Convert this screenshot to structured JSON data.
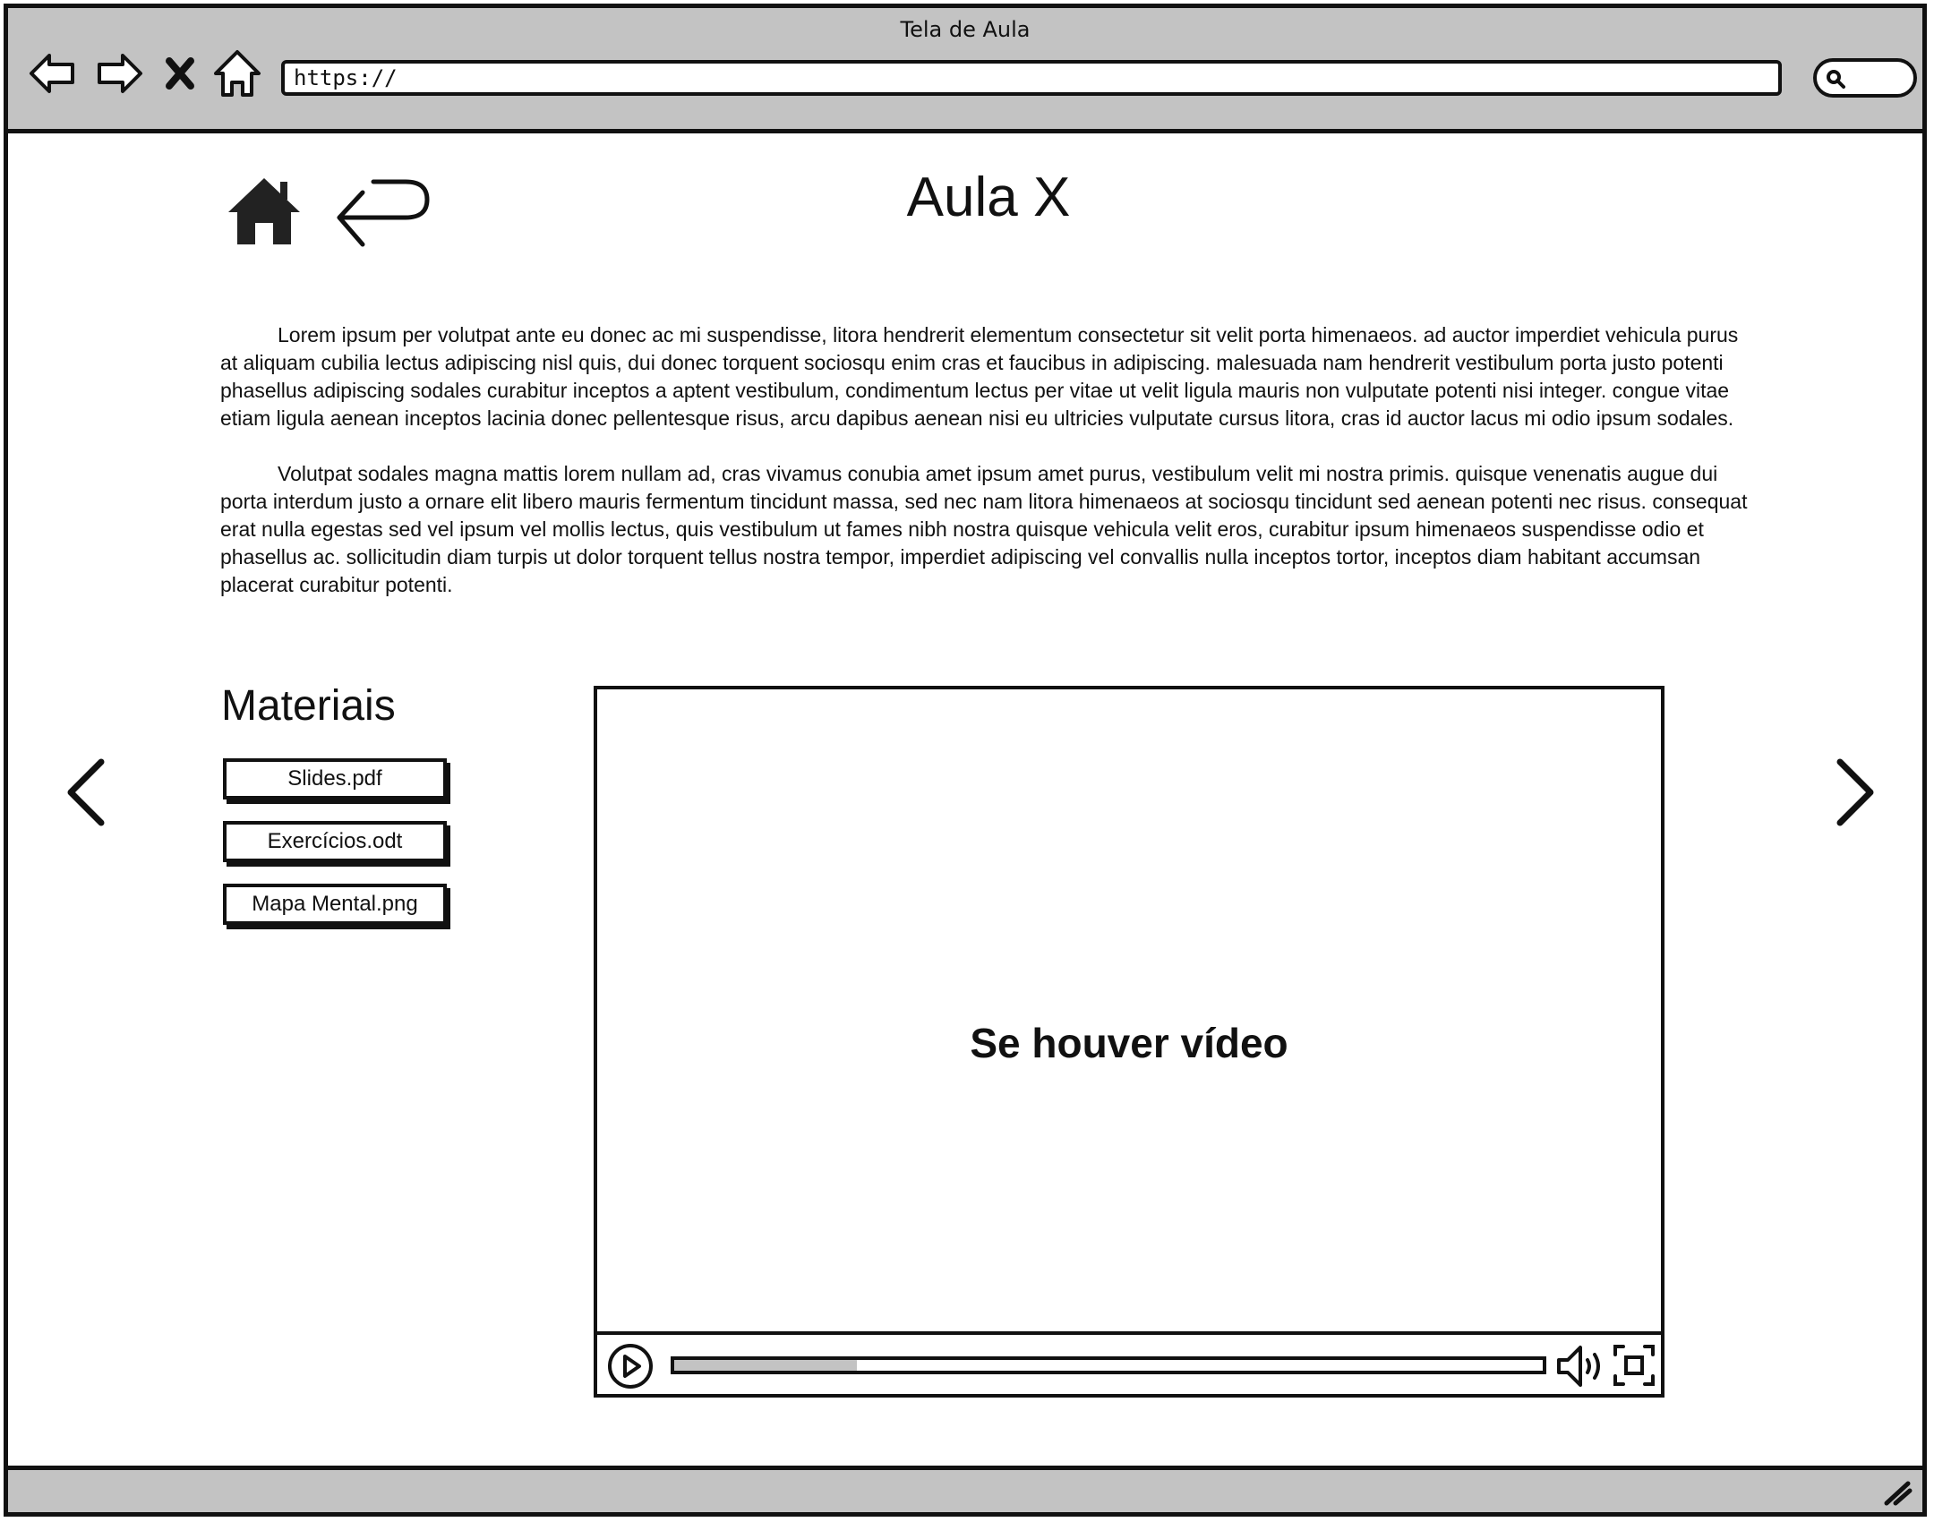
{
  "browser": {
    "window_title": "Tela de Aula",
    "address": "https://",
    "buttons": [
      "back-icon",
      "forward-icon",
      "close-icon",
      "home-icon"
    ],
    "search_icon": "search-icon"
  },
  "page": {
    "title": "Aula X",
    "nav": {
      "home_icon": "home-icon",
      "return_icon": "return-arrow-icon"
    },
    "paragraphs": [
      "Lorem ipsum per volutpat ante eu donec ac mi suspendisse, litora hendrerit elementum consectetur sit velit porta himenaeos. ad auctor imperdiet vehicula purus at aliquam cubilia lectus adipiscing nisl quis, dui donec torquent sociosqu enim cras et faucibus in adipiscing. malesuada nam hendrerit vestibulum porta justo potenti phasellus adipiscing sodales curabitur inceptos a aptent vestibulum, condimentum lectus per vitae ut velit ligula mauris non vulputate potenti nisi integer. congue vitae etiam ligula aenean inceptos lacinia donec pellentesque risus, arcu dapibus aenean nisi eu ultricies vulputate cursus litora, cras id auctor lacus mi odio ipsum sodales.",
      "Volutpat sodales magna mattis lorem nullam ad, cras vivamus conubia amet ipsum amet purus, vestibulum velit mi nostra primis. quisque venenatis augue dui porta interdum justo a ornare elit libero mauris fermentum tincidunt massa, sed nec nam litora himenaeos at sociosqu tincidunt sed aenean potenti nec risus. consequat erat nulla egestas sed vel ipsum vel mollis lectus, quis vestibulum ut fames nibh nostra quisque vehicula velit eros, curabitur ipsum himenaeos suspendisse odio et phasellus ac. sollicitudin diam turpis ut dolor torquent tellus nostra tempor, imperdiet adipiscing vel convallis nulla inceptos tortor, inceptos diam habitant accumsan placerat curabitur potenti."
    ],
    "materials": {
      "title": "Materiais",
      "files": [
        "Slides.pdf",
        "Exercícios.odt",
        "Mapa Mental.png"
      ]
    },
    "video": {
      "label": "Se houver vídeo",
      "progress_fraction": 0.21
    },
    "carousel": {
      "prev_icon": "chevron-left-icon",
      "next_icon": "chevron-right-icon"
    }
  },
  "colors": {
    "chrome": "#c3c3c3",
    "ink": "#111111",
    "background": "#ffffff"
  }
}
